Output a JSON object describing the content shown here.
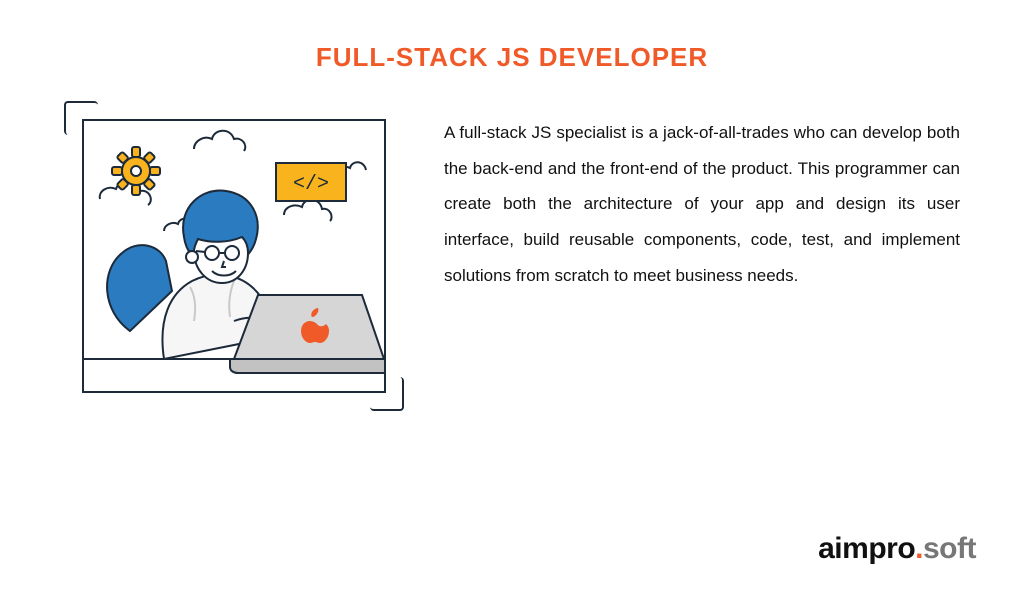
{
  "title": "FULL-STACK JS DEVELOPER",
  "description": "A full-stack JS specialist is a jack-of-all-trades who can develop both the back-end and the front-end of the product. This programmer can create both the architecture of your app and design its user interface, build reusable components, code, test, and implement solutions from scratch to meet business needs.",
  "code_tag": "</>",
  "brand": {
    "first": "aimpro",
    "dot": ".",
    "second": "soft"
  },
  "colors": {
    "accent": "#f05a28",
    "yellow": "#f9b41d",
    "blue": "#2a7bbf",
    "line": "#1c2a3a"
  }
}
